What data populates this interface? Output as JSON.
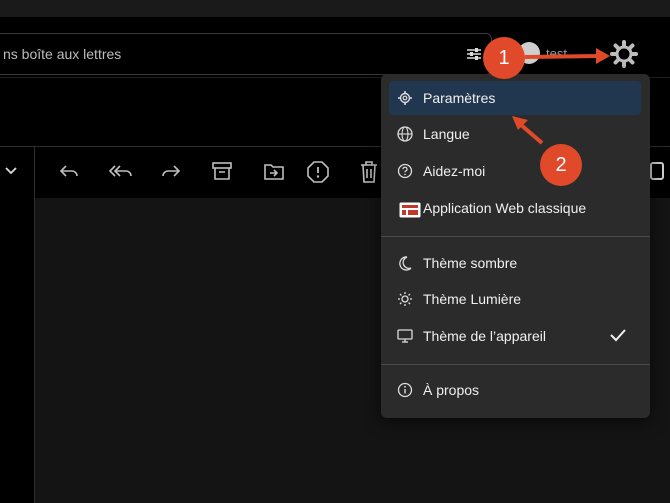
{
  "search": {
    "text": "ns boîte aux lettres"
  },
  "account": {
    "name": "test"
  },
  "menu": {
    "items": [
      {
        "label": "Paramètres",
        "icon": "gear-icon",
        "active": true
      },
      {
        "label": "Langue",
        "icon": "globe-icon"
      },
      {
        "label": "Aidez-moi",
        "icon": "help-icon"
      },
      {
        "label": "Application Web classique",
        "icon": "classic-app-icon"
      },
      {
        "label": "Thème sombre",
        "icon": "moon-icon"
      },
      {
        "label": "Thème Lumière",
        "icon": "sun-icon"
      },
      {
        "label": "Thème de l’appareil",
        "icon": "monitor-icon",
        "checked": true
      },
      {
        "label": "À propos",
        "icon": "info-icon"
      }
    ]
  },
  "annotations": {
    "badge1": "1",
    "badge2": "2"
  },
  "colors": {
    "accent": "#e04a2a",
    "active_item": "#21364f",
    "menu_bg": "#2b2b2b"
  }
}
